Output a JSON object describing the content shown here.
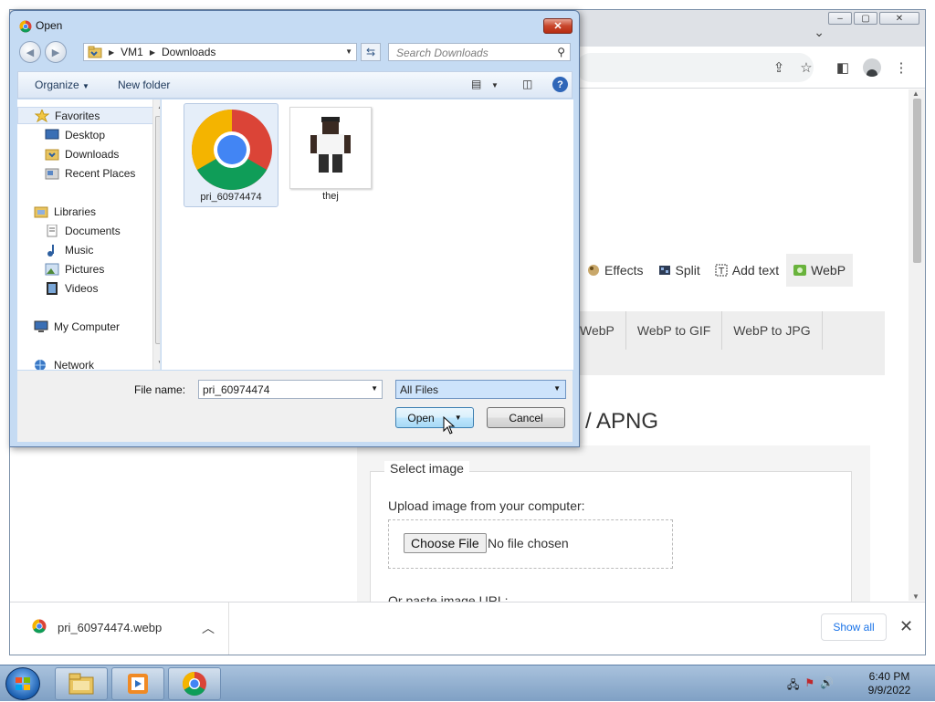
{
  "dialog": {
    "title": "Open",
    "breadcrumb": [
      "VM1",
      "Downloads"
    ],
    "search_placeholder": "Search Downloads",
    "toolbar": {
      "organize": "Organize",
      "new_folder": "New folder"
    },
    "tree": {
      "favorites": "Favorites",
      "desktop": "Desktop",
      "downloads": "Downloads",
      "recent_places": "Recent Places",
      "libraries": "Libraries",
      "documents": "Documents",
      "music": "Music",
      "pictures": "Pictures",
      "videos": "Videos",
      "my_computer": "My Computer",
      "network": "Network"
    },
    "files": [
      {
        "name": "pri_60974474",
        "icon": "chrome-icon",
        "selected": true
      },
      {
        "name": "thej",
        "icon": "character-thumbnail",
        "selected": false
      }
    ],
    "file_name_label": "File name:",
    "file_name_value": "pri_60974474",
    "file_type": "All Files",
    "open_label": "Open",
    "cancel_label": "Cancel",
    "close_glyph": "✕"
  },
  "browser": {
    "nav": [
      {
        "label": "Effects",
        "icon": "effects-icon"
      },
      {
        "label": "Split",
        "icon": "split-icon"
      },
      {
        "label": "Add text",
        "icon": "add-text-icon"
      },
      {
        "label": "WebP",
        "icon": "webp-icon",
        "active": true
      }
    ],
    "subnav": [
      "WebP",
      "WebP to GIF",
      "WebP to JPG"
    ],
    "heading": "/ APNG",
    "select_image_legend": "Select image",
    "upload_label": "Upload image from your computer:",
    "choose_file": "Choose File",
    "no_file": "No file chosen",
    "cut_text": "Or paste image URL:",
    "download": {
      "filename": "pri_60974474.webp",
      "show_all": "Show all"
    }
  },
  "taskbar": {
    "time": "6:40 PM",
    "date": "9/9/2022"
  }
}
